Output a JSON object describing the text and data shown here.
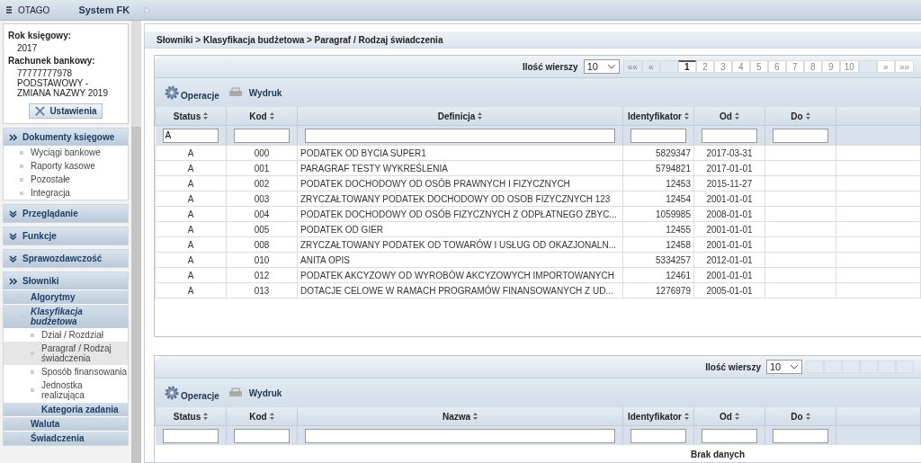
{
  "topbar": {
    "brand": "OTAGO",
    "title": "System FK"
  },
  "info": {
    "year_label": "Rok księgowy:",
    "year": "2017",
    "account_label": "Rachunek bankowy:",
    "account": "77777777978 PODSTAWOWY - ZMIANA NAZWY 2019",
    "settings_button": "Ustawienia"
  },
  "nav": [
    {
      "label": "Dokumenty księgowe",
      "expanded": true,
      "children": [
        {
          "label": "Wyciągi bankowe",
          "kind": "link",
          "selected": false
        },
        {
          "label": "Raporty kasowe",
          "kind": "link",
          "selected": false
        },
        {
          "label": "Pozostałe",
          "kind": "link",
          "selected": false
        },
        {
          "label": "Integracja",
          "kind": "link",
          "selected": false
        }
      ]
    },
    {
      "label": "Przeglądanie",
      "expanded": false
    },
    {
      "label": "Funkcje",
      "expanded": false
    },
    {
      "label": "Sprawozdawczość",
      "expanded": false
    },
    {
      "label": "Słowniki",
      "expanded": true,
      "children": [
        {
          "label": "Algorytmy",
          "kind": "group",
          "expanded": false
        },
        {
          "label": "Klasyfikacja budżetowa",
          "kind": "group",
          "expanded": true,
          "children": [
            {
              "label": "Dział / Rozdział",
              "selected": false
            },
            {
              "label": "Paragraf / Rodzaj świadczenia",
              "selected": true
            },
            {
              "label": "Sposób finansowania",
              "selected": false
            },
            {
              "label": "Jednostka realizująca",
              "selected": false
            }
          ]
        },
        {
          "label": "Kategoria zadania",
          "kind": "subgroup",
          "expanded": false
        },
        {
          "label": "Waluta",
          "kind": "group",
          "expanded": false
        },
        {
          "label": "Świadczenia",
          "kind": "group",
          "expanded": false
        }
      ]
    }
  ],
  "breadcrumb": "Słowniki > Klasyfikacja budżetowa > Paragraf / Rodzaj świadczenia",
  "grids": [
    {
      "pager": {
        "rows_label": "Ilość wierszy",
        "rows_value": "10",
        "buttons": [
          {
            "label": "««",
            "disabled": true
          },
          {
            "label": "«",
            "disabled": true
          },
          {
            "disabled": true
          },
          {
            "label": "1",
            "selected": true,
            "disabled": false
          },
          {
            "label": "2",
            "selected": false,
            "disabled": false
          },
          {
            "label": "3",
            "selected": false,
            "disabled": false
          },
          {
            "label": "4",
            "selected": false,
            "disabled": false
          },
          {
            "label": "5",
            "selected": false,
            "disabled": false
          },
          {
            "label": "6",
            "selected": false,
            "disabled": false
          },
          {
            "label": "7",
            "selected": false,
            "disabled": false
          },
          {
            "label": "8",
            "selected": false,
            "disabled": false
          },
          {
            "label": "9",
            "selected": false,
            "disabled": false
          },
          {
            "label": "10",
            "selected": false,
            "disabled": false
          },
          {
            "disabled": true
          },
          {
            "label": "»",
            "disabled": false
          },
          {
            "label": "»»",
            "disabled": false
          }
        ]
      },
      "toolbar": [
        "Operacje",
        "Wydruk"
      ],
      "columns": [
        "Status",
        "Kod",
        "Definicja",
        "Identyfikator",
        "Od",
        "Do"
      ],
      "filter_values": [
        "A"
      ],
      "rows": [
        [
          "A",
          "000",
          "PODATEK OD BYCIA SUPER1",
          "5829347",
          "2017-03-31"
        ],
        [
          "A",
          "001",
          "PARAGRAF TESTY WYKREŚLENIA",
          "5794821",
          "2017-01-01"
        ],
        [
          "A",
          "002",
          "PODATEK DOCHODOWY OD OSÓB PRAWNYCH I FIZYCZNYCH",
          "12453",
          "2015-11-27"
        ],
        [
          "A",
          "003",
          "ZRYCZAŁTOWANY PODATEK DOCHODOWY OD OSOB FIZYCZNYCH 123",
          "12454",
          "2001-01-01"
        ],
        [
          "A",
          "004",
          "PODATEK DOCHODOWY OD OSÓB FIZYCZNYCH Z ODPŁATNEGO ZBYC...",
          "1059985",
          "2008-01-01"
        ],
        [
          "A",
          "005",
          "PODATEK OD GIER",
          "12455",
          "2001-01-01"
        ],
        [
          "A",
          "008",
          "ZRYCZAŁTOWANY PODATEK OD TOWARÓW I USŁUG OD OKAZJONALN...",
          "12458",
          "2001-01-01"
        ],
        [
          "A",
          "010",
          "ANITA OPIS",
          "5334257",
          "2012-01-01"
        ],
        [
          "A",
          "012",
          "PODATEK AKCYZOWY OD WYROBÓW AKCYZOWYCH IMPORTOWANYCH",
          "12461",
          "2001-01-01"
        ],
        [
          "A",
          "013",
          "DOTACJE CELOWE W RAMACH PROGRAMÓW FINANSOWANYCH Z UD...",
          "1276979",
          "2005-01-01"
        ]
      ]
    },
    {
      "pager": {
        "rows_label": "Ilość wierszy",
        "rows_value": "10",
        "buttons": [
          {
            "disabled": true
          },
          {
            "disabled": true
          },
          {
            "disabled": true
          },
          {
            "disabled": true
          },
          {
            "disabled": true
          },
          {
            "disabled": true
          }
        ]
      },
      "toolbar": [
        "Operacje",
        "Wydruk"
      ],
      "columns": [
        "Status",
        "Kod",
        "Nazwa",
        "Identyfikator",
        "Od",
        "Do"
      ],
      "empty": "Brak danych"
    }
  ]
}
